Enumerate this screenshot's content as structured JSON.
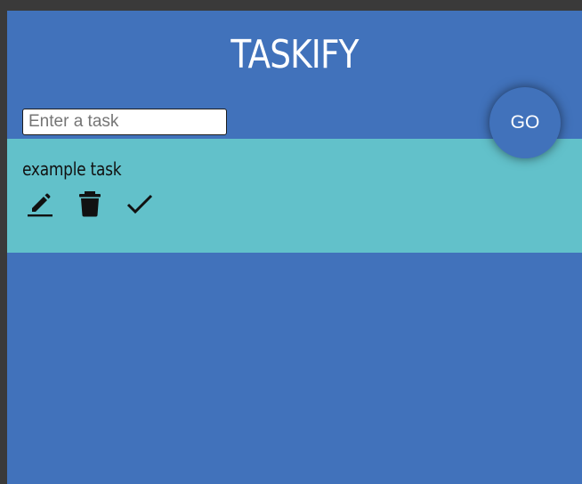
{
  "app": {
    "title": "TASKIFY"
  },
  "form": {
    "input_placeholder": "Enter a task",
    "input_value": "",
    "go_label": "GO"
  },
  "tasks": [
    {
      "text": "example task",
      "actions": [
        "edit-icon",
        "delete-icon",
        "done-icon"
      ]
    }
  ],
  "colors": {
    "background": "#4172bb",
    "task_list": "#62c1ca",
    "title": "#ffffff"
  }
}
